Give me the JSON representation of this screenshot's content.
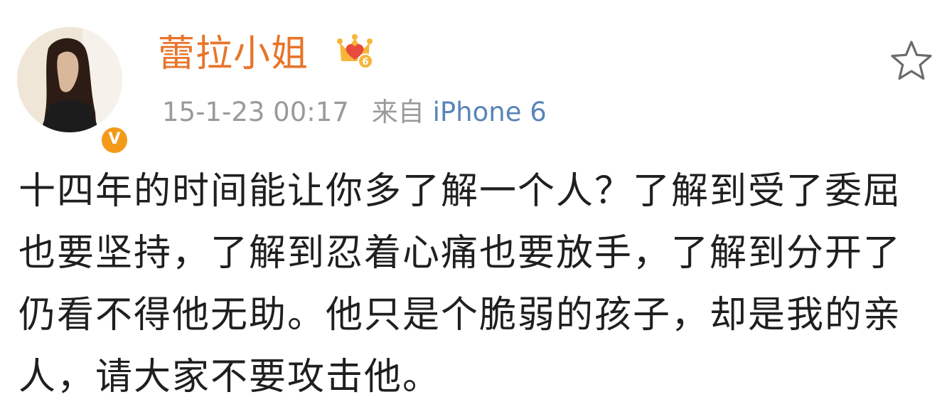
{
  "post": {
    "username": "蕾拉小姐",
    "vip_icon": "vip-crown-heart-icon",
    "verified_badge_letter": "V",
    "timestamp": "15-1-23 00:17",
    "source_prefix": "来自",
    "device": "iPhone 6",
    "favorite_icon": "star-outline-icon",
    "content": "十四年的时间能让你多了解一个人？了解到受了委屈也要坚持，了解到忍着心痛也要放手，了解到分开了仍看不得他无助。他只是个脆弱的孩子，却是我的亲人，请大家不要攻击他。"
  },
  "colors": {
    "username": "#e8742a",
    "meta": "#9a9a9a",
    "device_link": "#5a84b8",
    "badge": "#f39a19",
    "text": "#1f1f1f"
  }
}
